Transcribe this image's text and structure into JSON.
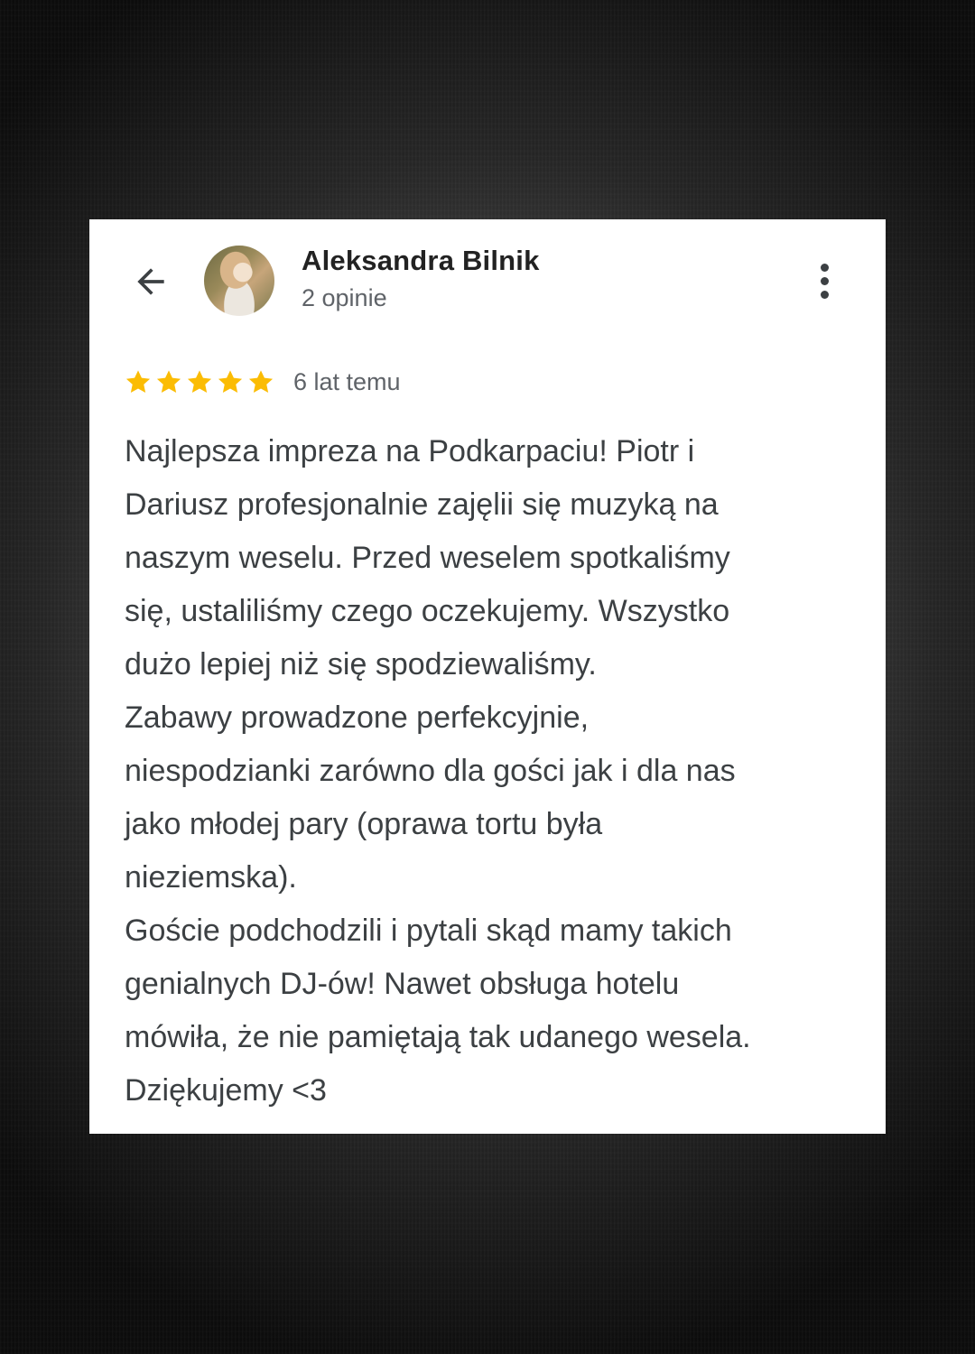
{
  "reviewer": {
    "name": "Aleksandra Bilnik",
    "review_count": "2 opinie",
    "avatar": "reviewer-photo"
  },
  "header": {
    "back_icon": "arrow-left-icon",
    "more_icon": "more-vert-icon"
  },
  "review": {
    "rating": 5,
    "rating_max": 5,
    "star_color": "#fbbc04",
    "time": "6 lat temu",
    "text": "Najlepsza impreza na Podkarpaciu! Piotr i\nDariusz profesjonalnie zajęlii się muzyką na\nnaszym weselu. Przed weselem spotkaliśmy\nsię, ustaliliśmy czego oczekujemy. Wszystko\ndużo lepiej niż się spodziewaliśmy.\nZabawy prowadzone perfekcyjnie,\nniespodzianki zarówno dla gości jak i dla nas\njako młodej pary (oprawa tortu była\nnieziemska).\nGoście podchodzili i pytali skąd mamy takich\ngenialnych DJ-ów! Nawet obsługa hotelu\nmówiła, że nie pamiętają tak udanego wesela.\nDziękujemy <3"
  }
}
